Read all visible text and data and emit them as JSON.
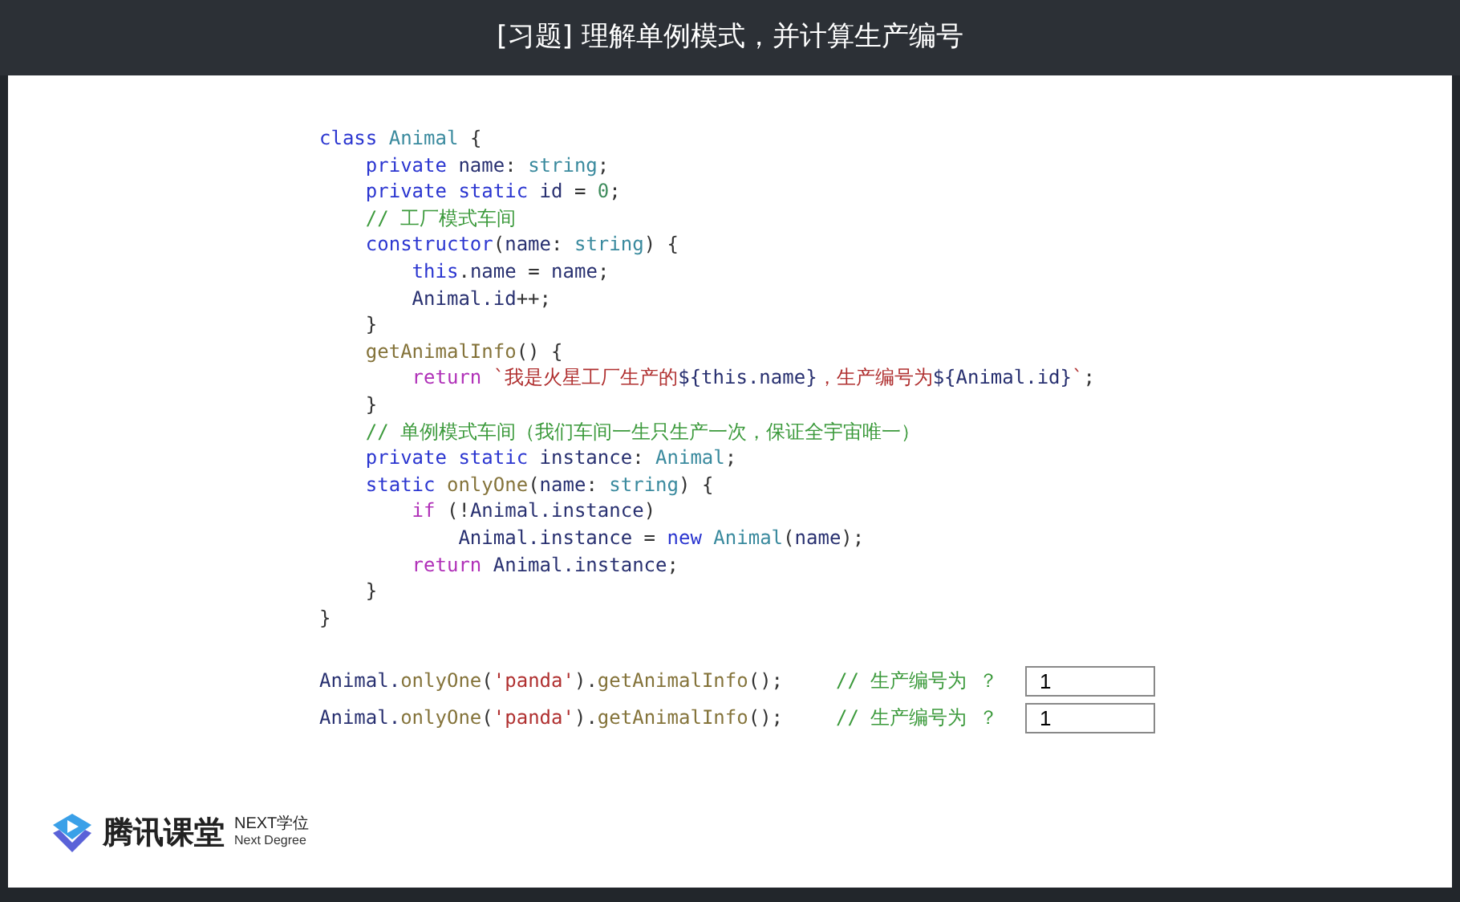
{
  "header": {
    "title": "[习题] 理解单例模式，并计算生产编号"
  },
  "code": [
    [
      {
        "kind": "kw",
        "text": "class "
      },
      {
        "kind": "type",
        "text": "Animal"
      },
      {
        "kind": "punc",
        "text": " {"
      }
    ],
    [
      {
        "kind": "kw",
        "text": "    private "
      },
      {
        "kind": "id",
        "text": "name"
      },
      {
        "kind": "punc",
        "text": ": "
      },
      {
        "kind": "type",
        "text": "string"
      },
      {
        "kind": "punc",
        "text": ";"
      }
    ],
    [
      {
        "kind": "kw",
        "text": "    private static "
      },
      {
        "kind": "id",
        "text": "id"
      },
      {
        "kind": "punc",
        "text": " = "
      },
      {
        "kind": "num",
        "text": "0"
      },
      {
        "kind": "punc",
        "text": ";"
      }
    ],
    [
      {
        "kind": "cmt",
        "text": "    // 工厂模式车间"
      }
    ],
    [
      {
        "kind": "kw",
        "text": "    constructor"
      },
      {
        "kind": "punc",
        "text": "("
      },
      {
        "kind": "id",
        "text": "name"
      },
      {
        "kind": "punc",
        "text": ": "
      },
      {
        "kind": "type",
        "text": "string"
      },
      {
        "kind": "punc",
        "text": ") {"
      }
    ],
    [
      {
        "kind": "kw",
        "text": "        this"
      },
      {
        "kind": "punc",
        "text": "."
      },
      {
        "kind": "id",
        "text": "name"
      },
      {
        "kind": "punc",
        "text": " = "
      },
      {
        "kind": "id",
        "text": "name"
      },
      {
        "kind": "punc",
        "text": ";"
      }
    ],
    [
      {
        "kind": "id",
        "text": "        Animal.id"
      },
      {
        "kind": "punc",
        "text": "++;"
      }
    ],
    [
      {
        "kind": "punc",
        "text": "    }"
      }
    ],
    [
      {
        "kind": "fn",
        "text": "    getAnimalInfo"
      },
      {
        "kind": "punc",
        "text": "() {"
      }
    ],
    [
      {
        "kind": "ctl",
        "text": "        return "
      },
      {
        "kind": "str",
        "text": "`我是火星工厂生产的"
      },
      {
        "kind": "id",
        "text": "${this.name}"
      },
      {
        "kind": "str",
        "text": "，生产编号为"
      },
      {
        "kind": "id",
        "text": "${Animal.id}"
      },
      {
        "kind": "str",
        "text": "`"
      },
      {
        "kind": "punc",
        "text": ";"
      }
    ],
    [
      {
        "kind": "punc",
        "text": "    }"
      }
    ],
    [
      {
        "kind": "cmt",
        "text": "    // 单例模式车间（我们车间一生只生产一次，保证全宇宙唯一）"
      }
    ],
    [
      {
        "kind": "kw",
        "text": "    private static "
      },
      {
        "kind": "id",
        "text": "instance"
      },
      {
        "kind": "punc",
        "text": ": "
      },
      {
        "kind": "type",
        "text": "Animal"
      },
      {
        "kind": "punc",
        "text": ";"
      }
    ],
    [
      {
        "kind": "kw",
        "text": "    static "
      },
      {
        "kind": "fn",
        "text": "onlyOne"
      },
      {
        "kind": "punc",
        "text": "("
      },
      {
        "kind": "id",
        "text": "name"
      },
      {
        "kind": "punc",
        "text": ": "
      },
      {
        "kind": "type",
        "text": "string"
      },
      {
        "kind": "punc",
        "text": ") {"
      }
    ],
    [
      {
        "kind": "ctl",
        "text": "        if "
      },
      {
        "kind": "punc",
        "text": "(!"
      },
      {
        "kind": "id",
        "text": "Animal.instance"
      },
      {
        "kind": "punc",
        "text": ")"
      }
    ],
    [
      {
        "kind": "id",
        "text": "            Animal.instance"
      },
      {
        "kind": "punc",
        "text": " = "
      },
      {
        "kind": "kw",
        "text": "new "
      },
      {
        "kind": "type",
        "text": "Animal"
      },
      {
        "kind": "punc",
        "text": "("
      },
      {
        "kind": "id",
        "text": "name"
      },
      {
        "kind": "punc",
        "text": ");"
      }
    ],
    [
      {
        "kind": "ctl",
        "text": "        return "
      },
      {
        "kind": "id",
        "text": "Animal.instance"
      },
      {
        "kind": "punc",
        "text": ";"
      }
    ],
    [
      {
        "kind": "punc",
        "text": "    }"
      }
    ],
    [
      {
        "kind": "punc",
        "text": "}"
      }
    ]
  ],
  "questions": [
    {
      "code": [
        {
          "kind": "id",
          "text": "Animal."
        },
        {
          "kind": "fn",
          "text": "onlyOne"
        },
        {
          "kind": "punc",
          "text": "("
        },
        {
          "kind": "str",
          "text": "'panda'"
        },
        {
          "kind": "punc",
          "text": ")."
        },
        {
          "kind": "fn",
          "text": "getAnimalInfo"
        },
        {
          "kind": "punc",
          "text": "();"
        }
      ],
      "comment": "// 生产编号为 ？",
      "answer": "1"
    },
    {
      "code": [
        {
          "kind": "id",
          "text": "Animal."
        },
        {
          "kind": "fn",
          "text": "onlyOne"
        },
        {
          "kind": "punc",
          "text": "("
        },
        {
          "kind": "str",
          "text": "'panda'"
        },
        {
          "kind": "punc",
          "text": ")."
        },
        {
          "kind": "fn",
          "text": "getAnimalInfo"
        },
        {
          "kind": "punc",
          "text": "();"
        }
      ],
      "comment": "// 生产编号为 ？",
      "answer": "1"
    }
  ],
  "logo": {
    "name": "腾讯课堂",
    "badge": "NEXT学位",
    "subtitle": "Next Degree"
  }
}
